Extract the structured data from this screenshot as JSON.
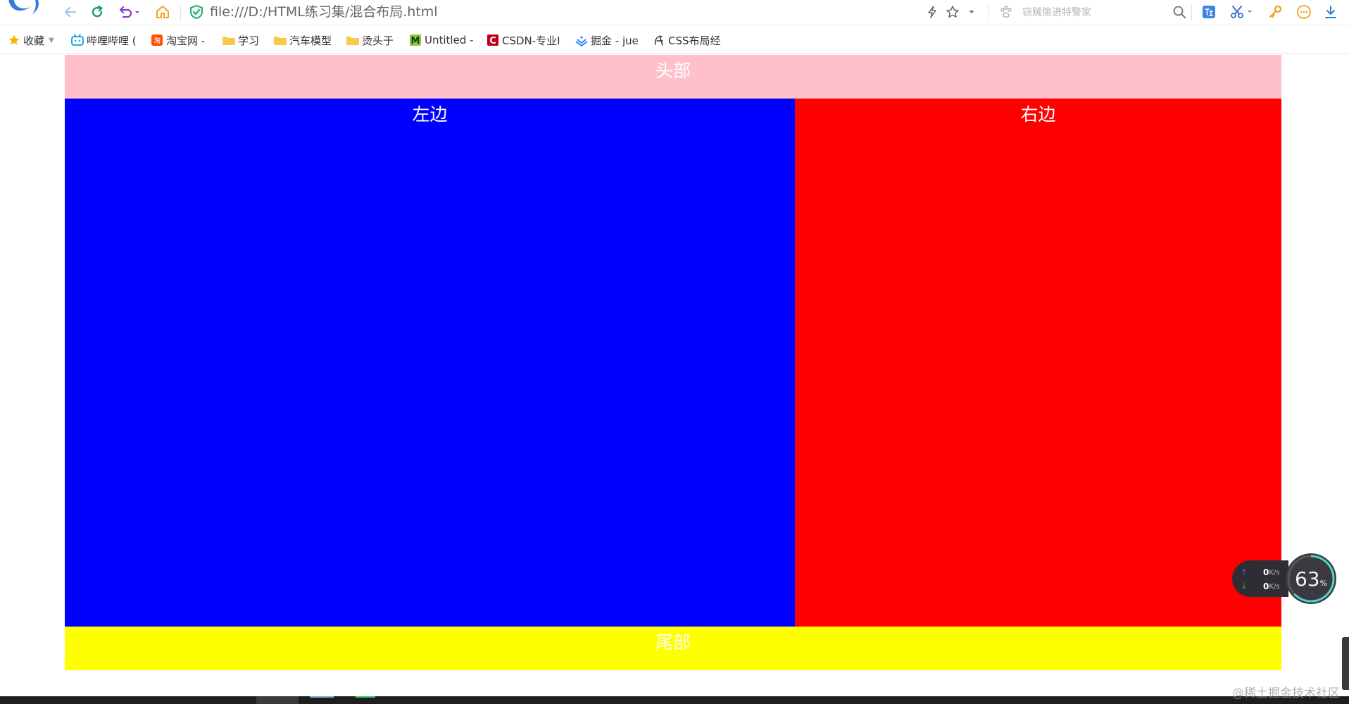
{
  "browser": {
    "url": "file:///D:/HTML练习集/混合布局.html",
    "search_placeholder": "窃贼偷进特警家"
  },
  "bookmarks": [
    {
      "label": "收藏",
      "icon": "star-icon"
    },
    {
      "label": "哔哩哔哩 (",
      "icon": "bilibili-icon"
    },
    {
      "label": "淘宝网 -",
      "icon": "taobao-icon"
    },
    {
      "label": "学习",
      "icon": "folder-icon"
    },
    {
      "label": "汽车模型",
      "icon": "folder-icon"
    },
    {
      "label": "烫头于",
      "icon": "folder-icon"
    },
    {
      "label": "Untitled -",
      "icon": "m-icon"
    },
    {
      "label": "CSDN-专业I",
      "icon": "csdn-icon"
    },
    {
      "label": "掘金 - jue",
      "icon": "juejin-icon"
    },
    {
      "label": "CSS布局经",
      "icon": "css-icon"
    }
  ],
  "layout": {
    "header": {
      "text": "头部",
      "color": "#ffc0cb"
    },
    "left": {
      "text": "左边",
      "color": "#0000ff"
    },
    "right": {
      "text": "右边",
      "color": "#ff0000"
    },
    "footer": {
      "text": "尾部",
      "color": "#ffff00"
    }
  },
  "network": {
    "upload": "0",
    "download": "0",
    "unit": "K/s",
    "usage": "63",
    "usage_suffix": "%"
  },
  "watermark": "@稀土掘金技术社区"
}
